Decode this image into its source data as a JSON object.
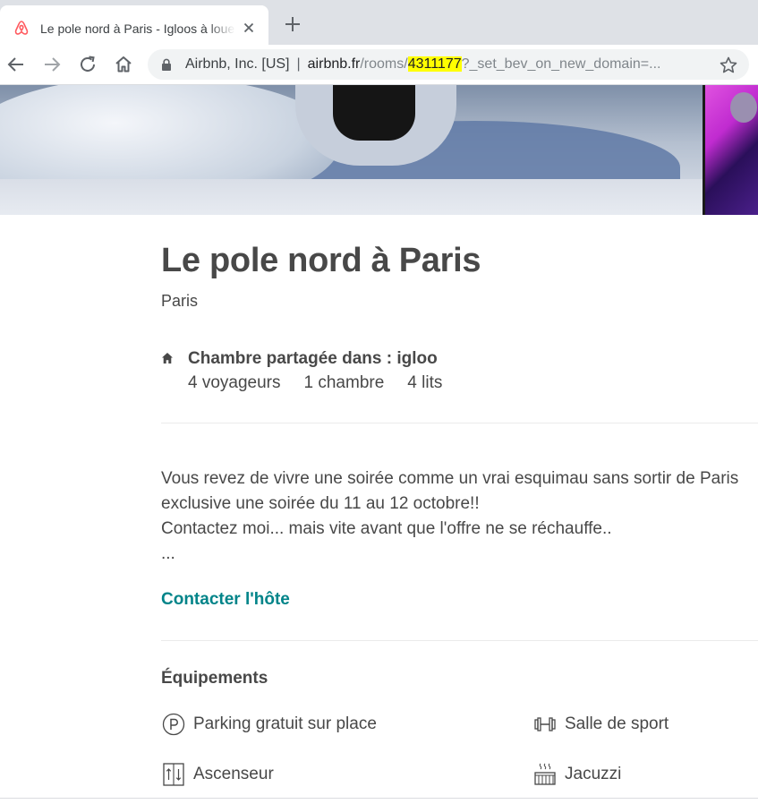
{
  "browser": {
    "tab_title": "Le pole nord à Paris - Igloos à louer",
    "url": {
      "org": "Airbnb, Inc. [US]",
      "separator": "|",
      "domain": "airbnb.fr",
      "path_before": "/rooms/",
      "highlighted_id": "4311177",
      "path_after": "?_set_bev_on_new_domain=..."
    },
    "icons": [
      "airbnb-favicon",
      "close-icon",
      "plus-icon",
      "back-arrow-icon",
      "forward-arrow-icon",
      "reload-icon",
      "home-icon",
      "lock-icon",
      "star-icon"
    ],
    "highlight_color": "#ffff00"
  },
  "listing": {
    "title": "Le pole nord à Paris",
    "city": "Paris",
    "room_type": "Chambre partagée dans : igloo",
    "stats": {
      "guests": "4 voyageurs",
      "bedrooms": "1 chambre",
      "beds": "4 lits"
    },
    "description": [
      "Vous revez de vivre une soirée comme un vrai esquimau sans sortir de Paris",
      "exclusive une soirée du 11 au 12 octobre!!",
      "Contactez moi... mais vite avant que l'offre ne se réchauffe..",
      "..."
    ],
    "contact_link": "Contacter l'hôte",
    "accent_color": "#008489"
  },
  "amenities": {
    "heading": "Équipements",
    "items": [
      {
        "label": "Parking gratuit sur place",
        "icon": "parking-icon"
      },
      {
        "label": "Salle de sport",
        "icon": "dumbbell-icon"
      },
      {
        "label": "Ascenseur",
        "icon": "elevator-icon"
      },
      {
        "label": "Jacuzzi",
        "icon": "hot-tub-icon"
      }
    ]
  }
}
